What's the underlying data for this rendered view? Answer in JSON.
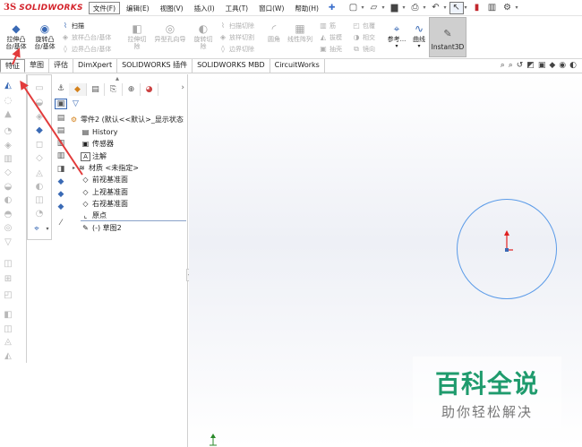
{
  "app": {
    "logo_mark": "3S",
    "brand": "SOLIDWORKS"
  },
  "menu": [
    {
      "label": "文件(F)",
      "active": true
    },
    {
      "label": "编辑(E)"
    },
    {
      "label": "视图(V)"
    },
    {
      "label": "插入(I)"
    },
    {
      "label": "工具(T)"
    },
    {
      "label": "窗口(W)"
    },
    {
      "label": "帮助(H)"
    }
  ],
  "ribbon": {
    "extrude_boss": {
      "line1": "拉伸凸",
      "line2": "台/基体"
    },
    "revolve_boss": {
      "line1": "旋转凸",
      "line2": "台/基体"
    },
    "sweep": "扫描",
    "loft_boss": "放样凸台/基体",
    "boundary_boss": "边界凸台/基体",
    "extrude_cut": {
      "line1": "拉伸切",
      "line2": "除"
    },
    "hole_wizard": {
      "line1": "异型孔向导",
      "line2": ""
    },
    "revolve_cut": {
      "line1": "旋转切",
      "line2": "除"
    },
    "swept_cut": "扫描切除",
    "lofted_cut": "放样切割",
    "boundary_cut": "边界切除",
    "fillet": "圆角",
    "linear_pattern": "线性阵列",
    "rib": "筋",
    "draft": "拔模",
    "shell": "抽壳",
    "wrap": "包覆",
    "intersect": "相交",
    "mirror": "镜向",
    "ref_geometry": "参考...",
    "curves": "曲线",
    "instant3d": "Instant3D"
  },
  "tabs": [
    {
      "label": "特征",
      "active": true
    },
    {
      "label": "草图"
    },
    {
      "label": "评估"
    },
    {
      "label": "DimXpert"
    },
    {
      "label": "SOLIDWORKS 插件"
    },
    {
      "label": "SOLIDWORKS MBD"
    },
    {
      "label": "CircuitWorks"
    }
  ],
  "feature_tree": [
    {
      "icon": "part-icon",
      "glyph": "⚙",
      "label": "零件2  (默认<<默认>_显示状态"
    },
    {
      "icon": "history-icon",
      "glyph": "▤",
      "label": "History"
    },
    {
      "icon": "sensor-icon",
      "glyph": "▣",
      "label": "传感器"
    },
    {
      "icon": "annotation-icon",
      "glyph": "A",
      "label": "注解"
    },
    {
      "icon": "material-icon",
      "glyph": "≋",
      "label": "材质 <未指定>"
    },
    {
      "icon": "plane-icon",
      "glyph": "◇",
      "label": "前视基准面"
    },
    {
      "icon": "plane-icon",
      "glyph": "◇",
      "label": "上视基准面"
    },
    {
      "icon": "plane-icon",
      "glyph": "◇",
      "label": "右视基准面"
    },
    {
      "icon": "origin-icon",
      "glyph": "⌞",
      "label": "原点"
    },
    {
      "icon": "sketch-icon",
      "glyph": "✎",
      "label": "(-) 草图2"
    }
  ],
  "watermark": {
    "title": "百科全说",
    "subtitle": "助你轻松解决"
  },
  "colors": {
    "brand_red": "#d4232b",
    "sketch_blue": "#5b9be8",
    "arrow_red": "#e23b3b",
    "watermark_green": "#1f9b6d"
  }
}
